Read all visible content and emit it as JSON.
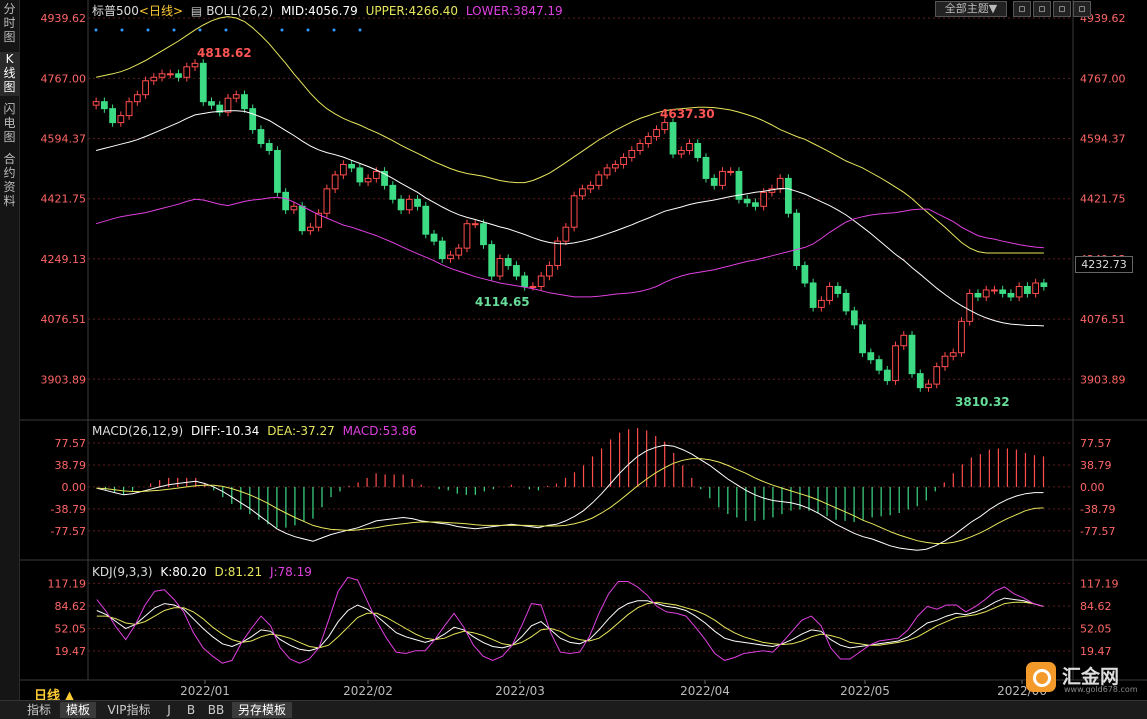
{
  "sidebar": {
    "tabs": [
      {
        "label": "分时图",
        "active": false
      },
      {
        "label": "K线图",
        "active": true
      },
      {
        "label": "闪电图",
        "active": false
      },
      {
        "label": "合约资料",
        "active": false
      }
    ]
  },
  "main_header": {
    "symbol": "标普500",
    "period": "<日线>",
    "indicator": "BOLL(26,2)",
    "mid": "MID:4056.79",
    "upper": "UPPER:4266.40",
    "lower": "LOWER:3847.19"
  },
  "macd_header": {
    "name": "MACD(26,12,9)",
    "diff": "DIFF:-10.34",
    "dea": "DEA:-37.27",
    "macd": "MACD:53.86"
  },
  "kdj_header": {
    "name": "KDJ(9,3,3)",
    "k": "K:80.20",
    "d": "D:81.21",
    "j": "J:78.19"
  },
  "toolbar": {
    "theme_label": "全部主题▼",
    "win_buttons": [
      "▫",
      "▫",
      "▫",
      "▫"
    ]
  },
  "last_price": "4232.73",
  "timeframe_label": "日线 ▲",
  "bottom_tabs": [
    {
      "label": "指标",
      "active": false
    },
    {
      "label": "模板",
      "active": true
    },
    {
      "label": "VIP指标",
      "active": false
    },
    {
      "label": "J",
      "active": false
    },
    {
      "label": "B",
      "active": false
    },
    {
      "label": "BB",
      "active": false
    },
    {
      "label": "另存模板",
      "active": true
    }
  ],
  "logo": {
    "text": "汇金网",
    "url": "www.gold678.com"
  },
  "colors": {
    "up": "#ff4d4d",
    "down": "#3ddc84",
    "mid": "#ffffff",
    "upper": "#e6e65c",
    "lower": "#e040e0",
    "grid": "#5a2020",
    "axis_text": "#ff6666"
  },
  "chart_data": [
    {
      "type": "candlestick",
      "title": "标普500 日线 BOLL(26,2)",
      "y_ticks": [
        "4939.62",
        "4767.00",
        "4594.37",
        "4421.75",
        "4249.13",
        "4076.51",
        "3903.89"
      ],
      "y_range": [
        3810,
        4940
      ],
      "x_ticks": [
        "2022/01",
        "2022/02",
        "2022/03",
        "2022/04",
        "2022/05",
        "2022/06"
      ],
      "annotations": [
        {
          "text": "4818.62",
          "color": "red"
        },
        {
          "text": "4637.30",
          "color": "red"
        },
        {
          "text": "4114.65",
          "color": "green"
        },
        {
          "text": "3810.32",
          "color": "green"
        }
      ],
      "series": {
        "close": [
          4700,
          4680,
          4640,
          4660,
          4700,
          4720,
          4760,
          4770,
          4780,
          4780,
          4770,
          4800,
          4810,
          4700,
          4690,
          4670,
          4710,
          4720,
          4680,
          4620,
          4580,
          4560,
          4440,
          4390,
          4400,
          4330,
          4340,
          4380,
          4450,
          4490,
          4520,
          4510,
          4470,
          4480,
          4500,
          4460,
          4420,
          4390,
          4420,
          4400,
          4320,
          4300,
          4250,
          4260,
          4280,
          4350,
          4350,
          4290,
          4200,
          4250,
          4230,
          4200,
          4170,
          4170,
          4200,
          4230,
          4300,
          4340,
          4430,
          4450,
          4460,
          4490,
          4510,
          4520,
          4540,
          4560,
          4580,
          4600,
          4620,
          4640,
          4550,
          4560,
          4580,
          4540,
          4480,
          4460,
          4500,
          4500,
          4420,
          4410,
          4400,
          4440,
          4450,
          4480,
          4380,
          4230,
          4180,
          4110,
          4130,
          4170,
          4150,
          4100,
          4060,
          3980,
          3960,
          3930,
          3900,
          4000,
          4030,
          3920,
          3880,
          3890,
          3940,
          3970,
          3980,
          4070,
          4150,
          4140,
          4160,
          4160,
          4150,
          4140,
          4170,
          4150,
          4180,
          4170
        ],
        "mid": [
          4560,
          4566,
          4572,
          4578,
          4584,
          4591,
          4600,
          4610,
          4620,
          4630,
          4640,
          4652,
          4662,
          4666,
          4670,
          4672,
          4674,
          4674,
          4672,
          4665,
          4656,
          4646,
          4632,
          4617,
          4603,
          4587,
          4573,
          4562,
          4554,
          4548,
          4541,
          4532,
          4523,
          4514,
          4504,
          4493,
          4480,
          4466,
          4453,
          4440,
          4424,
          4411,
          4398,
          4386,
          4376,
          4368,
          4362,
          4355,
          4348,
          4341,
          4335,
          4327,
          4319,
          4310,
          4302,
          4296,
          4293,
          4292,
          4295,
          4300,
          4306,
          4313,
          4321,
          4329,
          4338,
          4347,
          4357,
          4366,
          4376,
          4386,
          4392,
          4398,
          4405,
          4410,
          4414,
          4418,
          4423,
          4428,
          4432,
          4436,
          4440,
          4443,
          4447,
          4451,
          4450,
          4443,
          4435,
          4424,
          4413,
          4402,
          4389,
          4375,
          4358,
          4340,
          4322,
          4302,
          4282,
          4262,
          4245,
          4224,
          4205,
          4185,
          4165,
          4147,
          4130,
          4115,
          4102,
          4090,
          4080,
          4072,
          4066,
          4062,
          4060,
          4058,
          4058,
          4057
        ],
        "upper": [
          4770,
          4775,
          4780,
          4786,
          4795,
          4806,
          4818,
          4832,
          4846,
          4860,
          4874,
          4890,
          4906,
          4920,
          4932,
          4940,
          4944,
          4940,
          4930,
          4912,
          4890,
          4866,
          4838,
          4810,
          4780,
          4752,
          4724,
          4700,
          4680,
          4665,
          4652,
          4642,
          4633,
          4622,
          4612,
          4600,
          4588,
          4575,
          4563,
          4552,
          4540,
          4528,
          4518,
          4508,
          4500,
          4494,
          4490,
          4486,
          4480,
          4474,
          4470,
          4468,
          4468,
          4474,
          4484,
          4495,
          4510,
          4526,
          4542,
          4558,
          4574,
          4590,
          4604,
          4618,
          4630,
          4642,
          4652,
          4660,
          4668,
          4674,
          4678,
          4680,
          4682,
          4684,
          4684,
          4683,
          4680,
          4676,
          4670,
          4663,
          4655,
          4645,
          4633,
          4620,
          4610,
          4600,
          4592,
          4580,
          4568,
          4556,
          4543,
          4530,
          4520,
          4510,
          4497,
          4484,
          4470,
          4455,
          4440,
          4422,
          4400,
          4380,
          4360,
          4340,
          4318,
          4296,
          4280,
          4270,
          4266,
          4266,
          4266,
          4266,
          4266,
          4266,
          4266,
          4266
        ],
        "lower": [
          4350,
          4357,
          4364,
          4370,
          4374,
          4378,
          4382,
          4388,
          4394,
          4400,
          4406,
          4414,
          4420,
          4418,
          4412,
          4406,
          4402,
          4408,
          4414,
          4418,
          4420,
          4424,
          4426,
          4422,
          4412,
          4400,
          4388,
          4376,
          4366,
          4356,
          4346,
          4340,
          4332,
          4324,
          4316,
          4306,
          4296,
          4285,
          4274,
          4264,
          4254,
          4244,
          4232,
          4222,
          4214,
          4206,
          4198,
          4192,
          4186,
          4180,
          4176,
          4172,
          4168,
          4164,
          4158,
          4152,
          4148,
          4144,
          4140,
          4140,
          4140,
          4142,
          4145,
          4148,
          4150,
          4152,
          4156,
          4162,
          4170,
          4182,
          4192,
          4200,
          4206,
          4210,
          4214,
          4218,
          4224,
          4230,
          4236,
          4242,
          4246,
          4252,
          4258,
          4264,
          4270,
          4276,
          4282,
          4292,
          4308,
          4325,
          4340,
          4355,
          4364,
          4370,
          4375,
          4378,
          4380,
          4382,
          4386,
          4390,
          4392,
          4392,
          4380,
          4368,
          4356,
          4340,
          4328,
          4316,
          4310,
          4306,
          4300,
          4295,
          4290,
          4286,
          4283,
          4281
        ]
      }
    },
    {
      "type": "macd",
      "title": "MACD(26,12,9)",
      "y_ticks": [
        "77.57",
        "38.79",
        "0.00",
        "-38.79",
        "-77.57"
      ],
      "y_range": [
        -115,
        90
      ],
      "series": {
        "diff": [
          -2,
          -6,
          -10,
          -14,
          -12,
          -8,
          -4,
          0,
          4,
          6,
          8,
          10,
          6,
          0,
          -8,
          -18,
          -28,
          -38,
          -50,
          -62,
          -74,
          -82,
          -88,
          -92,
          -96,
          -90,
          -84,
          -80,
          -76,
          -72,
          -66,
          -60,
          -58,
          -56,
          -54,
          -56,
          -60,
          -62,
          -64,
          -66,
          -70,
          -72,
          -74,
          -72,
          -70,
          -68,
          -66,
          -68,
          -70,
          -72,
          -68,
          -66,
          -60,
          -52,
          -42,
          -28,
          -12,
          6,
          24,
          40,
          54,
          64,
          70,
          74,
          72,
          66,
          58,
          48,
          38,
          26,
          14,
          4,
          -6,
          -14,
          -20,
          -24,
          -26,
          -28,
          -32,
          -38,
          -46,
          -56,
          -66,
          -74,
          -82,
          -88,
          -92,
          -98,
          -104,
          -108,
          -110,
          -112,
          -110,
          -104,
          -96,
          -86,
          -74,
          -62,
          -52,
          -40,
          -30,
          -22,
          -16,
          -12,
          -10,
          -10
        ],
        "dea": [
          -2,
          -3,
          -5,
          -7,
          -8,
          -8,
          -7,
          -6,
          -4,
          -2,
          0,
          2,
          3,
          3,
          1,
          -3,
          -8,
          -14,
          -21,
          -29,
          -38,
          -46,
          -54,
          -61,
          -68,
          -72,
          -75,
          -76,
          -77,
          -76,
          -74,
          -72,
          -69,
          -67,
          -65,
          -63,
          -62,
          -62,
          -62,
          -63,
          -64,
          -65,
          -67,
          -68,
          -68,
          -68,
          -68,
          -68,
          -68,
          -69,
          -69,
          -69,
          -68,
          -65,
          -61,
          -55,
          -46,
          -36,
          -24,
          -11,
          2,
          14,
          25,
          34,
          42,
          47,
          50,
          50,
          48,
          44,
          38,
          31,
          24,
          16,
          9,
          3,
          -2,
          -7,
          -12,
          -17,
          -23,
          -30,
          -37,
          -44,
          -51,
          -59,
          -65,
          -72,
          -79,
          -85,
          -90,
          -95,
          -98,
          -100,
          -100,
          -98,
          -94,
          -88,
          -81,
          -73,
          -64,
          -56,
          -49,
          -42,
          -38,
          -37
        ]
      }
    },
    {
      "type": "kdj",
      "title": "KDJ(9,3,3)",
      "y_ticks": [
        "117.19",
        "84.62",
        "52.05",
        "19.47"
      ],
      "y_range": [
        -5,
        125
      ],
      "series": {
        "k": [
          78,
          72,
          62,
          52,
          58,
          70,
          82,
          88,
          86,
          80,
          66,
          52,
          40,
          30,
          26,
          32,
          40,
          50,
          48,
          36,
          28,
          22,
          20,
          24,
          40,
          62,
          78,
          86,
          80,
          70,
          58,
          46,
          40,
          36,
          32,
          36,
          44,
          54,
          50,
          40,
          32,
          26,
          24,
          28,
          40,
          56,
          62,
          50,
          38,
          32,
          30,
          36,
          50,
          66,
          80,
          88,
          92,
          92,
          88,
          84,
          82,
          78,
          70,
          60,
          48,
          38,
          34,
          32,
          30,
          28,
          26,
          30,
          36,
          44,
          50,
          48,
          36,
          28,
          24,
          26,
          28,
          30,
          32,
          34,
          40,
          50,
          60,
          64,
          70,
          74,
          72,
          76,
          82,
          90,
          96,
          94,
          92,
          88,
          84
        ],
        "d": [
          70,
          70,
          66,
          60,
          58,
          62,
          70,
          78,
          82,
          82,
          76,
          66,
          54,
          44,
          36,
          32,
          34,
          40,
          44,
          42,
          38,
          32,
          26,
          24,
          28,
          40,
          54,
          68,
          74,
          74,
          68,
          60,
          52,
          44,
          38,
          36,
          38,
          44,
          48,
          46,
          42,
          36,
          30,
          28,
          32,
          40,
          50,
          52,
          48,
          40,
          36,
          34,
          38,
          48,
          60,
          72,
          82,
          88,
          90,
          88,
          86,
          82,
          78,
          72,
          64,
          54,
          46,
          40,
          36,
          32,
          30,
          29,
          30,
          34,
          40,
          44,
          42,
          38,
          32,
          30,
          28,
          28,
          30,
          32,
          35,
          40,
          48,
          56,
          62,
          68,
          70,
          72,
          76,
          82,
          88,
          90,
          90,
          88,
          84
        ],
        "j": [
          94,
          76,
          54,
          36,
          58,
          86,
          106,
          108,
          94,
          76,
          46,
          24,
          12,
          2,
          6,
          32,
          52,
          70,
          56,
          24,
          8,
          2,
          8,
          24,
          64,
          106,
          126,
          122,
          92,
          62,
          38,
          18,
          16,
          20,
          20,
          36,
          56,
          74,
          54,
          28,
          12,
          6,
          12,
          28,
          56,
          88,
          86,
          46,
          18,
          16,
          18,
          40,
          74,
          102,
          120,
          120,
          112,
          100,
          84,
          76,
          74,
          70,
          54,
          36,
          16,
          6,
          10,
          16,
          18,
          20,
          18,
          32,
          48,
          64,
          70,
          56,
          24,
          8,
          8,
          18,
          28,
          34,
          36,
          38,
          50,
          70,
          84,
          80,
          86,
          86,
          76,
          84,
          94,
          106,
          112,
          102,
          96,
          88,
          84
        ]
      }
    }
  ]
}
